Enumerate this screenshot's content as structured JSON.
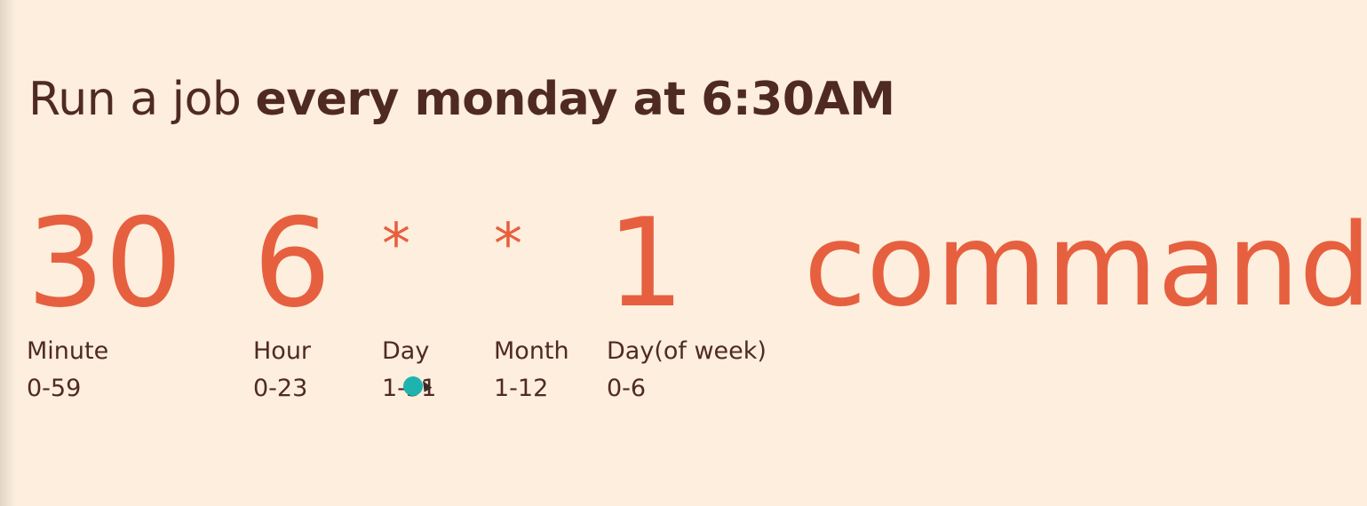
{
  "heading": {
    "prefix": "Run a job ",
    "emphasis": "every monday at 6:30AM"
  },
  "fields": {
    "minute": {
      "value": "30",
      "label": "Minute",
      "range": "0-59"
    },
    "hour": {
      "value": "6",
      "label": "Hour",
      "range": "0-23"
    },
    "day": {
      "value": "*",
      "label": "Day",
      "range": "1-31"
    },
    "month": {
      "value": "*",
      "label": "Month",
      "range": "1-12"
    },
    "day_of_week": {
      "value": "1",
      "label": "Day(of week)",
      "range": "0-6"
    }
  },
  "command": "command",
  "colors": {
    "background": "#fdeedd",
    "accent": "#e6603f",
    "text": "#4f2a23",
    "cursor": "#1fb3b0"
  },
  "icons": {
    "cursor": "mouse-cursor-icon"
  }
}
